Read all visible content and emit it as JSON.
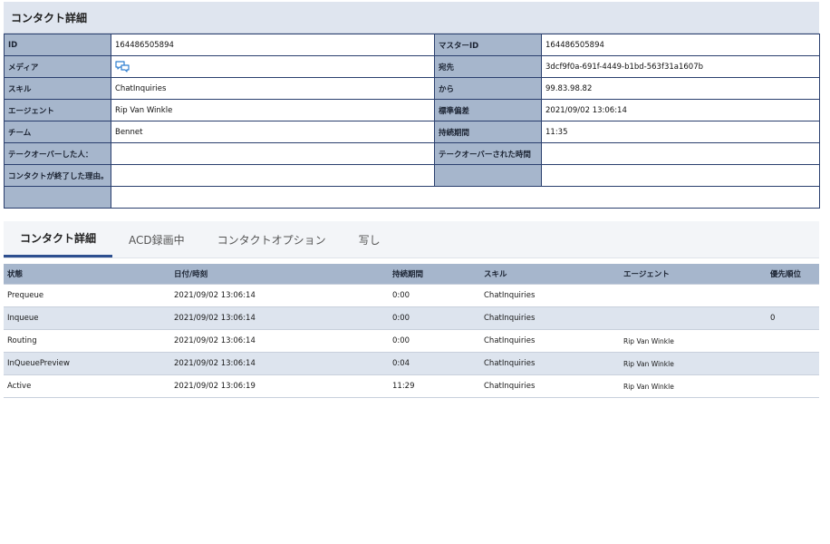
{
  "title": "コンタクト詳細",
  "details": {
    "rows": [
      {
        "l1": "ID",
        "v1": "164486505894",
        "l2": "マスターID",
        "v2": "164486505894"
      },
      {
        "l1": "メディア",
        "v1": "",
        "l2": "宛先",
        "v2": "3dcf9f0a-691f-4449-b1bd-563f31a1607b"
      },
      {
        "l1": "スキル",
        "v1": "ChatInquiries",
        "l2": "から",
        "v2": "99.83.98.82"
      },
      {
        "l1": "エージェント",
        "v1": "Rip Van Winkle",
        "l2": "標準偏差",
        "v2": "2021/09/02 13:06:14"
      },
      {
        "l1": "チーム",
        "v1": "Bennet",
        "l2": "持続期間",
        "v2": "11:35"
      },
      {
        "l1": "テークオーバーした人：",
        "v1": "",
        "l2": "テークオーバーされた時間",
        "v2": ""
      },
      {
        "l1": "コンタクトが終了した理由。",
        "v1": "",
        "l2": "",
        "v2": ""
      },
      {
        "l1": "",
        "v1": "",
        "l2": "",
        "v2": ""
      }
    ],
    "media_icon": "chat-bubbles-icon"
  },
  "tabs": [
    "コンタクト詳細",
    "ACD録画中",
    "コンタクトオプション",
    "写し"
  ],
  "active_tab": "コンタクト詳細",
  "history": {
    "columns": [
      "状態",
      "日付/時刻",
      "持続期間",
      "スキル",
      "エージェント",
      "優先順位"
    ],
    "rows": [
      {
        "state": "Prequeue",
        "datetime": "2021/09/02 13:06:14",
        "duration": "0:00",
        "skill": "ChatInquiries",
        "agent": "",
        "priority": ""
      },
      {
        "state": "Inqueue",
        "datetime": "2021/09/02 13:06:14",
        "duration": "0:00",
        "skill": "ChatInquiries",
        "agent": "",
        "priority": "0"
      },
      {
        "state": "Routing",
        "datetime": "2021/09/02 13:06:14",
        "duration": "0:00",
        "skill": "ChatInquiries",
        "agent": "Rip Van Winkle",
        "priority": ""
      },
      {
        "state": "InQueuePreview",
        "datetime": "2021/09/02 13:06:14",
        "duration": "0:04",
        "skill": "ChatInquiries",
        "agent": "Rip Van Winkle",
        "priority": ""
      },
      {
        "state": "Active",
        "datetime": "2021/09/02 13:06:19",
        "duration": "11:29",
        "skill": "ChatInquiries",
        "agent": "Rip Van Winkle",
        "priority": ""
      }
    ]
  },
  "colors": {
    "label_bg": "#a6b6cc",
    "accent": "#2d4f8f",
    "title_bg": "#dfe5ef",
    "icon": "#2f7fd0"
  }
}
